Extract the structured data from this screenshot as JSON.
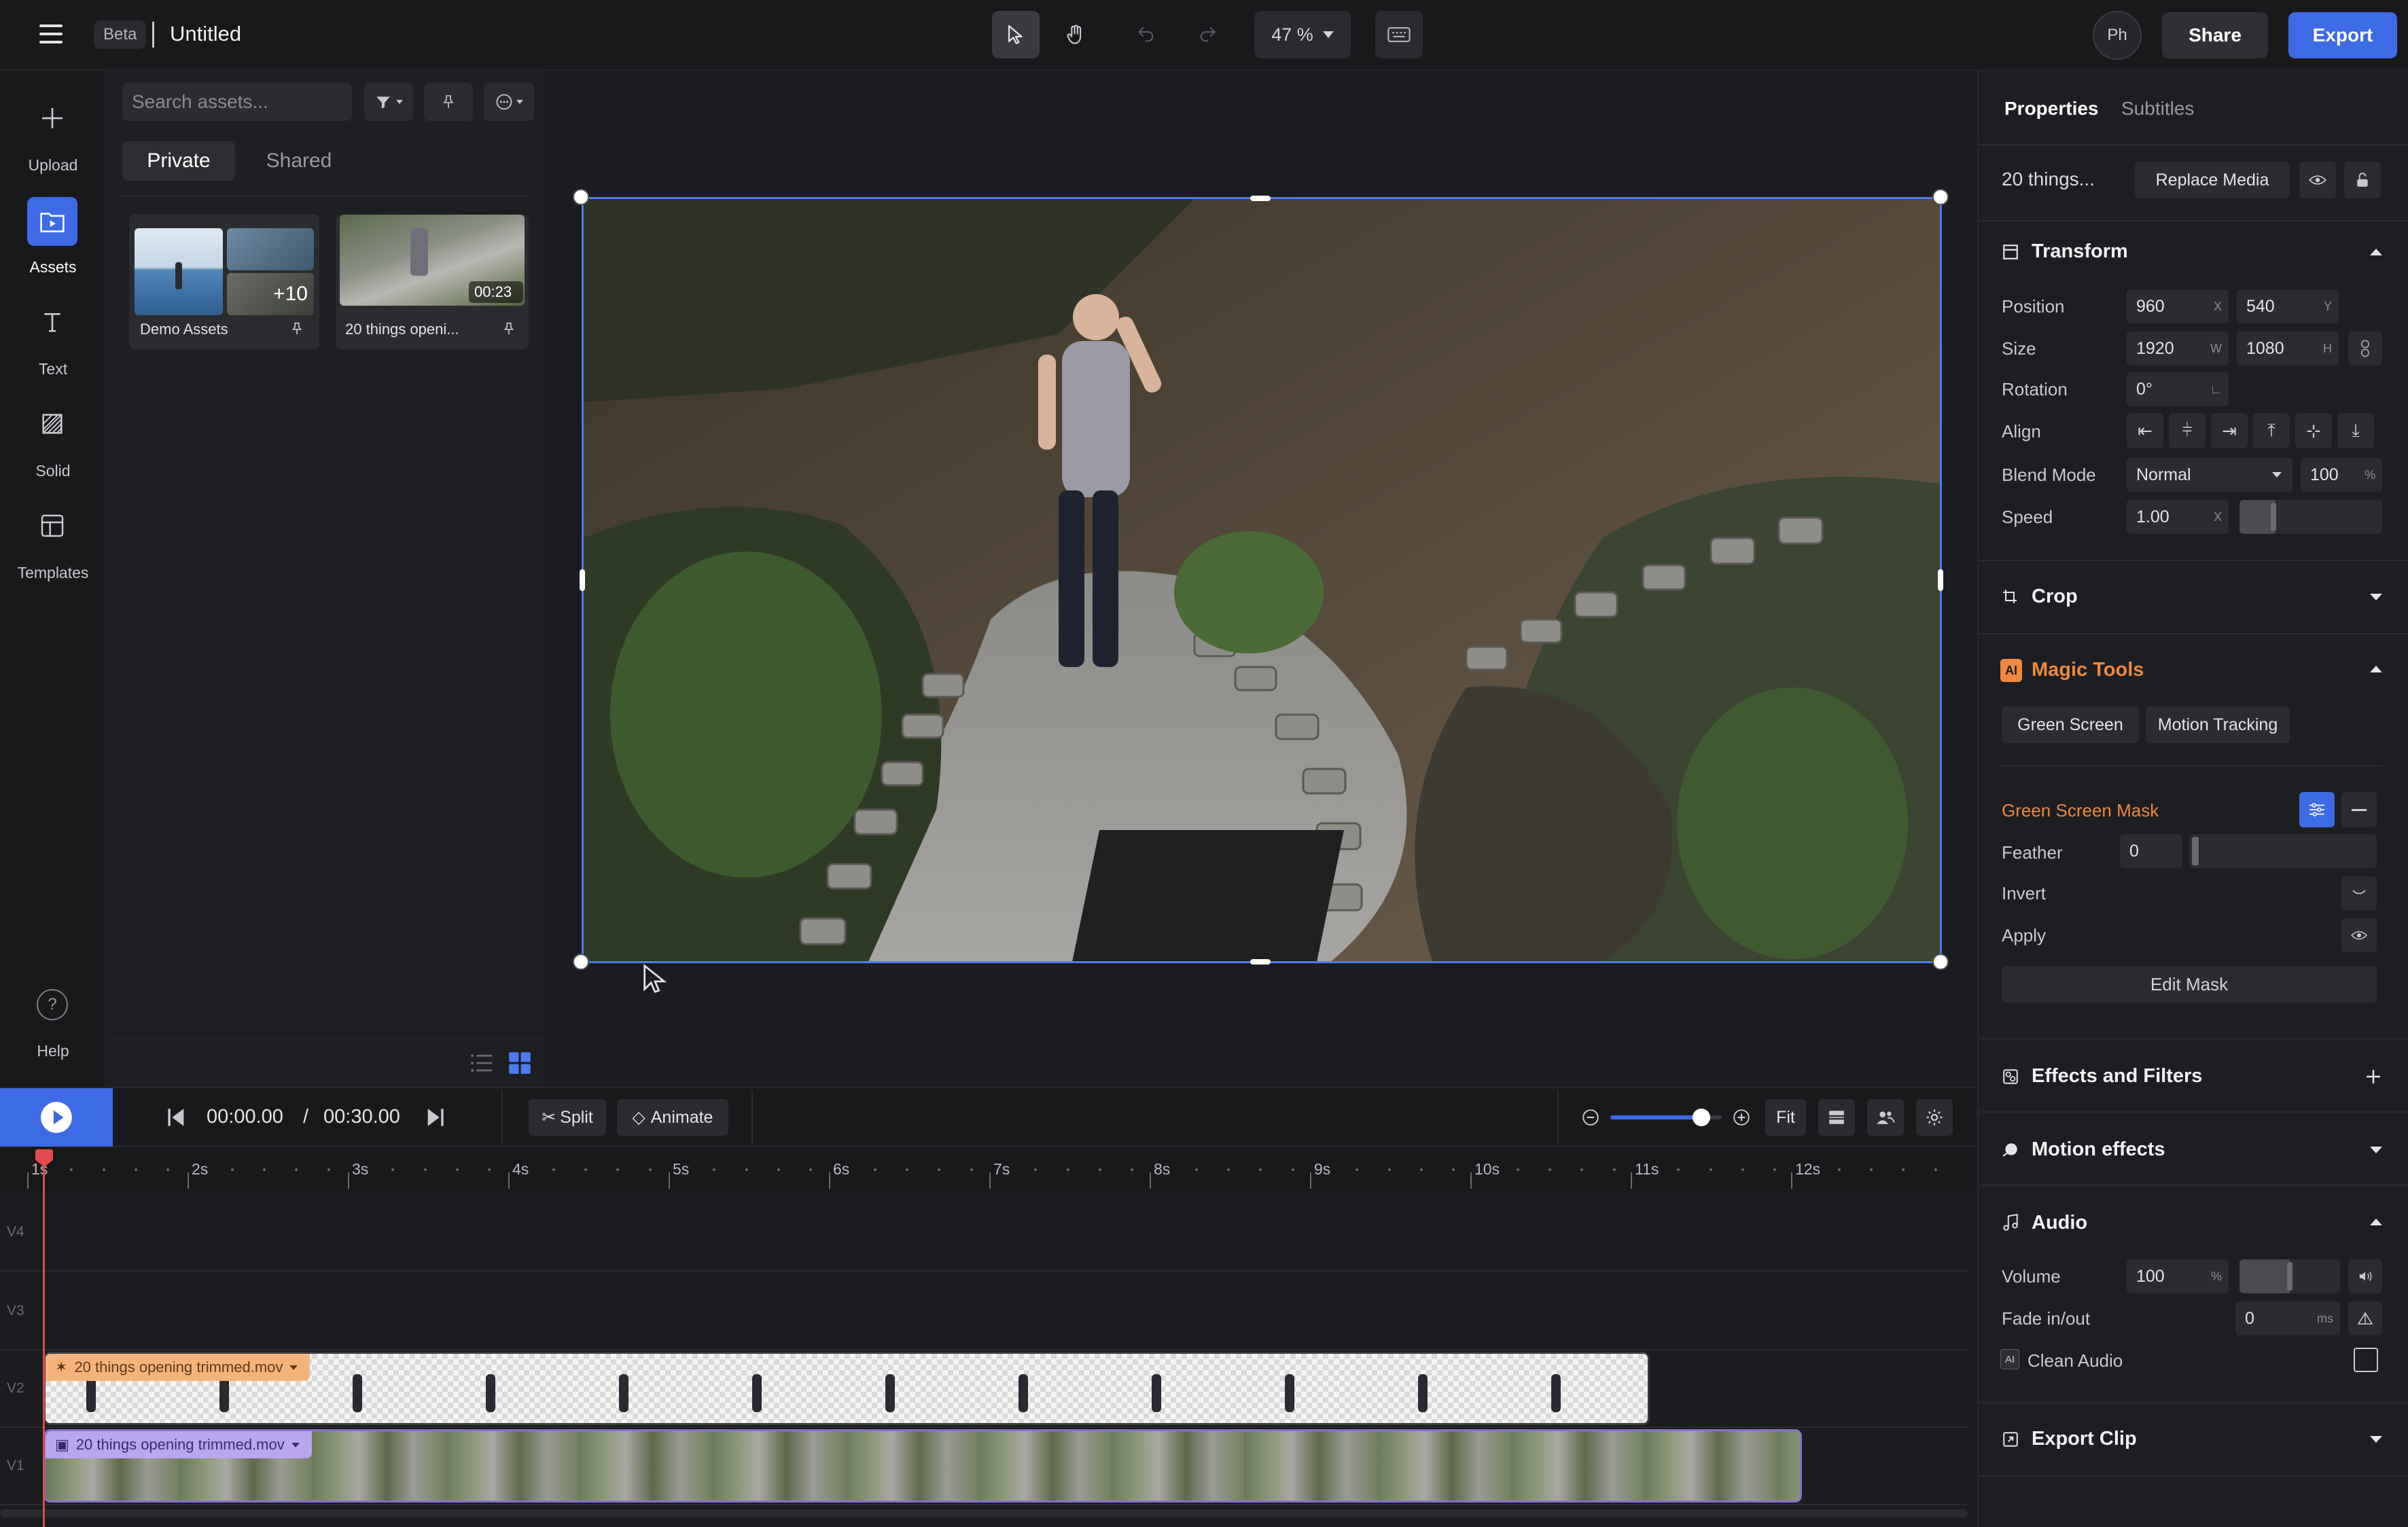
{
  "app": {
    "badge": "Beta",
    "title": "Untitled"
  },
  "toolbar": {
    "zoom": "47 %",
    "profile": "Ph",
    "share_label": "Share",
    "export_label": "Export"
  },
  "rail": {
    "items": [
      {
        "label": "Upload",
        "icon": "plus-icon"
      },
      {
        "label": "Assets",
        "icon": "folder-play-icon"
      },
      {
        "label": "Text",
        "icon": "text-icon"
      },
      {
        "label": "Solid",
        "icon": "solid-hatch-icon"
      },
      {
        "label": "Templates",
        "icon": "templates-icon"
      }
    ],
    "help_label": "Help"
  },
  "assets": {
    "search_placeholder": "Search assets...",
    "tabs": [
      "Private",
      "Shared"
    ],
    "cards": [
      {
        "label": "Demo Assets",
        "count": "+10"
      },
      {
        "label": "20 things openi...",
        "duration": "00:23"
      }
    ]
  },
  "properties": {
    "tabs": [
      "Properties",
      "Subtitles"
    ],
    "media_name": "20 things...",
    "replace_label": "Replace Media",
    "transform": {
      "title": "Transform",
      "position_label": "Position",
      "pos_x": "960",
      "pos_y": "540",
      "size_label": "Size",
      "width": "1920",
      "height": "1080",
      "rotation_label": "Rotation",
      "rotation": "0°",
      "align_label": "Align",
      "blend_label": "Blend Mode",
      "blend": "Normal",
      "opacity": "100",
      "speed_label": "Speed",
      "speed": "1.00",
      "unit_x": "X",
      "unit_y": "Y",
      "unit_w": "W",
      "unit_h": "H",
      "unit_pct": "%",
      "unit_speed": "X"
    },
    "crop_title": "Crop",
    "magic": {
      "ai_badge": "AI",
      "title": "Magic Tools",
      "green_screen": "Green Screen",
      "motion_tracking": "Motion Tracking",
      "mask_label": "Green Screen Mask",
      "feather_label": "Feather",
      "feather": "0",
      "invert_label": "Invert",
      "apply_label": "Apply",
      "edit_mask": "Edit Mask"
    },
    "effects_title": "Effects and Filters",
    "motion_title": "Motion effects",
    "audio": {
      "title": "Audio",
      "volume_label": "Volume",
      "volume": "100",
      "volume_unit": "%",
      "fade_label": "Fade in/out",
      "fade": "0",
      "fade_unit": "ms",
      "clean_label": "Clean Audio",
      "clean_badge": "AI"
    },
    "export_clip": "Export Clip"
  },
  "timeline": {
    "current": "00:00.00",
    "separator": "/",
    "total": "00:30.00",
    "split_label": "Split",
    "animate_label": "Animate",
    "fit_label": "Fit",
    "zoom_level": 0.82,
    "ruler": [
      "1s",
      "2s",
      "3s",
      "4s",
      "5s",
      "6s",
      "7s",
      "8s",
      "9s",
      "10s",
      "11s",
      "12s"
    ],
    "tracks": [
      "V4",
      "V3",
      "V2",
      "V1"
    ],
    "clip_v2": "20 things opening trimmed.mov",
    "clip_v1": "20 things opening trimmed.mov"
  },
  "colors": {
    "accent": "#3d6be6",
    "ai_orange": "#f0883e",
    "playhead": "#e5484d",
    "clip_purple": "#8b6fd1",
    "clip_tag_orange": "#f5b37c"
  }
}
